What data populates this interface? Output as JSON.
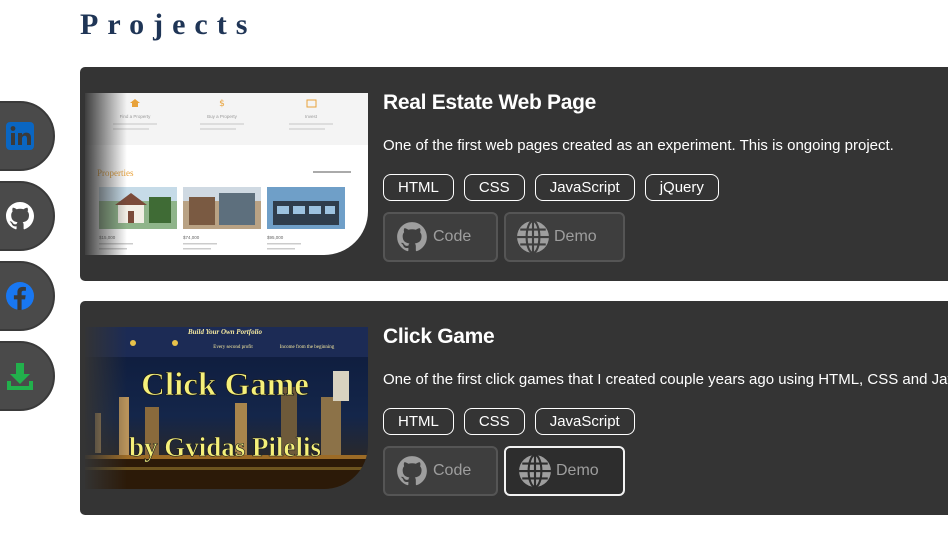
{
  "page": {
    "title": "Projects"
  },
  "social": [
    {
      "name": "linkedin",
      "icon": "linkedin-icon",
      "color": "#0a66c2"
    },
    {
      "name": "github",
      "icon": "github-icon",
      "color": "#ffffff"
    },
    {
      "name": "facebook",
      "icon": "facebook-icon",
      "color": "#1877f2"
    },
    {
      "name": "download",
      "icon": "download-icon",
      "color": "#22b14c"
    }
  ],
  "projects": [
    {
      "title": "Real Estate Web Page",
      "description": "One of the first web pages created as an experiment. This is ongoing project.",
      "tags": [
        "HTML",
        "CSS",
        "JavaScript",
        "jQuery"
      ],
      "code_label": "Code",
      "demo_label": "Demo",
      "thumbnail": {
        "heading": "Properties",
        "features": [
          "Find a Property",
          "Buy a Property",
          "Invest"
        ],
        "prices": [
          "$15,000",
          "$74,000",
          "$95,000"
        ]
      }
    },
    {
      "title": "Click Game",
      "description": "One of the first click games that I created couple years ago using HTML, CSS and JavaScript.",
      "tags": [
        "HTML",
        "CSS",
        "JavaScript"
      ],
      "code_label": "Code",
      "demo_label": "Demo",
      "thumbnail": {
        "header": "Build Your Own Portfolio",
        "col_a": "Every second profit",
        "col_b": "Income from the beginning",
        "line1": "Click Game",
        "line2": "by Gvidas Pilelis"
      }
    }
  ],
  "colors": {
    "card_bg": "#343434",
    "title": "#1f3556",
    "accent_yellow": "#f5f07a",
    "accent_orange": "#e8a23a"
  }
}
